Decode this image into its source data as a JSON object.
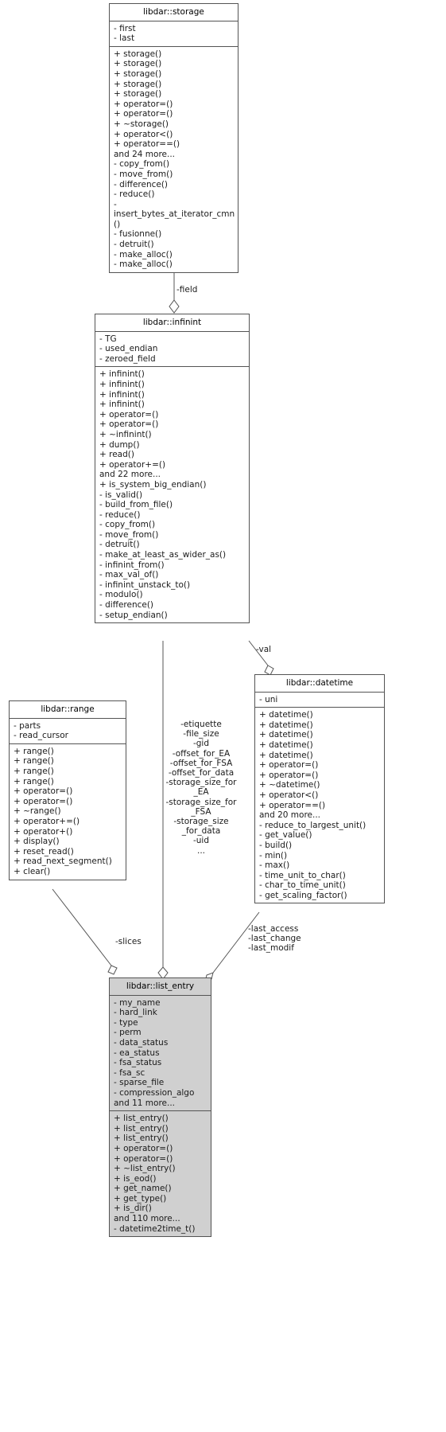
{
  "diagram": {
    "type": "uml-class-collaboration-diagram",
    "stroke_color": "#545454",
    "text_color": "#1a1a1a",
    "highlight_fill": "#d0d0d0",
    "background": "#ffffff"
  },
  "classes": {
    "storage": {
      "name": "libdar::storage",
      "attributes": [
        "- first",
        "- last"
      ],
      "methods": [
        "+ storage()",
        "+ storage()",
        "+ storage()",
        "+ storage()",
        "+ storage()",
        "+ operator=()",
        "+ operator=()",
        "+ ~storage()",
        "+ operator<()",
        "+ operator==()",
        "and 24 more...",
        "- copy_from()",
        "- move_from()",
        "- difference()",
        "- reduce()",
        "- insert_bytes_at_iterator_cmn()",
        "- fusionne()",
        "- detruit()",
        "- make_alloc()",
        "- make_alloc()"
      ]
    },
    "infinint": {
      "name": "libdar::infinint",
      "attributes": [
        "- TG",
        "- used_endian",
        "- zeroed_field"
      ],
      "methods": [
        "+ infinint()",
        "+ infinint()",
        "+ infinint()",
        "+ infinint()",
        "+ operator=()",
        "+ operator=()",
        "+ ~infinint()",
        "+ dump()",
        "+ read()",
        "+ operator+=()",
        "and 22 more...",
        "+ is_system_big_endian()",
        "- is_valid()",
        "- build_from_file()",
        "- reduce()",
        "- copy_from()",
        "- move_from()",
        "- detruit()",
        "- make_at_least_as_wider_as()",
        "- infinint_from()",
        "- max_val_of()",
        "- infinint_unstack_to()",
        "- modulo()",
        "- difference()",
        "- setup_endian()"
      ]
    },
    "datetime": {
      "name": "libdar::datetime",
      "attributes": [
        "- uni"
      ],
      "methods": [
        "+ datetime()",
        "+ datetime()",
        "+ datetime()",
        "+ datetime()",
        "+ datetime()",
        "+ operator=()",
        "+ operator=()",
        "+ ~datetime()",
        "+ operator<()",
        "+ operator==()",
        "and 20 more...",
        "- reduce_to_largest_unit()",
        "- get_value()",
        "- build()",
        "- min()",
        "- max()",
        "- time_unit_to_char()",
        "- char_to_time_unit()",
        "- get_scaling_factor()"
      ]
    },
    "range": {
      "name": "libdar::range",
      "attributes": [
        "- parts",
        "- read_cursor"
      ],
      "methods": [
        "+ range()",
        "+ range()",
        "+ range()",
        "+ range()",
        "+ operator=()",
        "+ operator=()",
        "+ ~range()",
        "+ operator+=()",
        "+ operator+()",
        "+ display()",
        "+ reset_read()",
        "+ read_next_segment()",
        "+ clear()"
      ]
    },
    "list_entry": {
      "name": "libdar::list_entry",
      "attributes": [
        "- my_name",
        "- hard_link",
        "- type",
        "- perm",
        "- data_status",
        "- ea_status",
        "- fsa_status",
        "- fsa_sc",
        "- sparse_file",
        "- compression_algo",
        "and 11 more..."
      ],
      "methods": [
        "+ list_entry()",
        "+ list_entry()",
        "+ list_entry()",
        "+ operator=()",
        "+ operator=()",
        "+ ~list_entry()",
        "+ is_eod()",
        "+ get_name()",
        "+ get_type()",
        "+ is_dir()",
        "and 110 more...",
        "- datetime2time_t()"
      ]
    }
  },
  "edges": [
    {
      "id": "storage-infinint",
      "label": "-field",
      "from": "storage",
      "to": "infinint"
    },
    {
      "id": "infinint-datetime",
      "label": "-val",
      "from": "infinint",
      "to": "datetime"
    },
    {
      "id": "infinint-list_entry",
      "label": "-etiquette\n-file_size\n-gid\n-offset_for_EA\n-offset_for_FSA\n-offset_for_data\n-storage_size_for\n_EA\n-storage_size_for\n_FSA\n-storage_size\n_for_data\n-uid\n...",
      "from": "infinint",
      "to": "list_entry"
    },
    {
      "id": "range-list_entry",
      "label": "-slices",
      "from": "range",
      "to": "list_entry"
    },
    {
      "id": "datetime-list_entry",
      "label": "-last_access\n-last_change\n-last_modif",
      "from": "datetime",
      "to": "list_entry"
    }
  ]
}
